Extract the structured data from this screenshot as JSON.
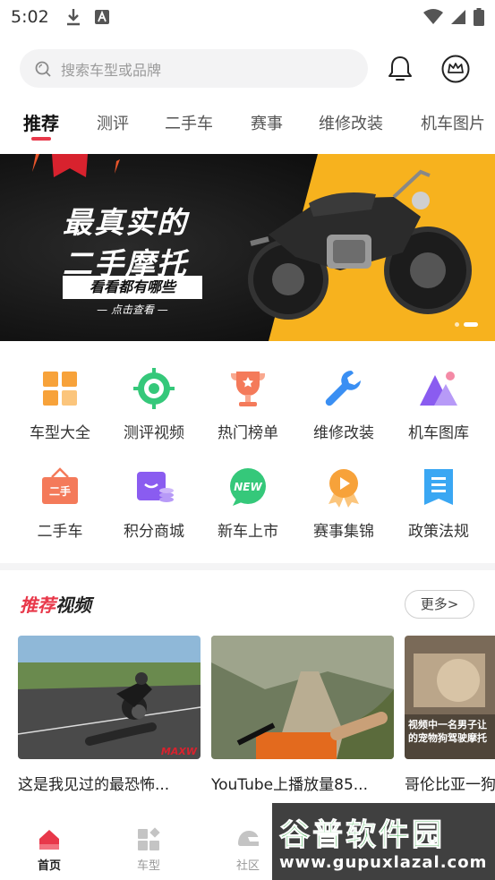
{
  "status_bar": {
    "time": "5:02"
  },
  "search": {
    "placeholder": "搜索车型或品牌"
  },
  "tabs": [
    {
      "label": "推荐"
    },
    {
      "label": "测评"
    },
    {
      "label": "二手车"
    },
    {
      "label": "赛事"
    },
    {
      "label": "维修改装"
    },
    {
      "label": "机车图片"
    }
  ],
  "active_tab": "推荐",
  "banner": {
    "line1": "最真实的",
    "line2": "二手摩托",
    "tag": "看看都有哪些",
    "cta": "— 点击查看 —"
  },
  "grid": [
    {
      "label": "车型大全",
      "icon": "car-models-icon"
    },
    {
      "label": "测评视频",
      "icon": "review-video-icon"
    },
    {
      "label": "热门榜单",
      "icon": "trophy-icon"
    },
    {
      "label": "维修改装",
      "icon": "wrench-icon"
    },
    {
      "label": "机车图库",
      "icon": "gallery-icon"
    },
    {
      "label": "二手车",
      "icon": "used-car-icon"
    },
    {
      "label": "积分商城",
      "icon": "points-mall-icon"
    },
    {
      "label": "新车上市",
      "icon": "new-badge-icon"
    },
    {
      "label": "赛事集锦",
      "icon": "medal-icon"
    },
    {
      "label": "政策法规",
      "icon": "policy-icon"
    }
  ],
  "section": {
    "title_red": "推荐",
    "title_rest": "视频",
    "more_label": "更多>"
  },
  "videos": [
    {
      "title": "这是我见过的最恐怖..."
    },
    {
      "title": "YouTube上播放量85..."
    },
    {
      "title": "哥伦比亚一狗"
    }
  ],
  "video3_overlay": "视频中一名男子让的宠物狗驾驶摩托",
  "video1_overlay": "MAXW",
  "bottom_nav": [
    {
      "label": "首页"
    },
    {
      "label": "车型"
    },
    {
      "label": "社区"
    }
  ],
  "watermark": {
    "main": "谷普软件园",
    "url": "www.gupuxlazal.com"
  },
  "colors": {
    "accent": "#e8384a",
    "banner_yellow": "#f7b21e",
    "active_nav": "#e8384a"
  }
}
